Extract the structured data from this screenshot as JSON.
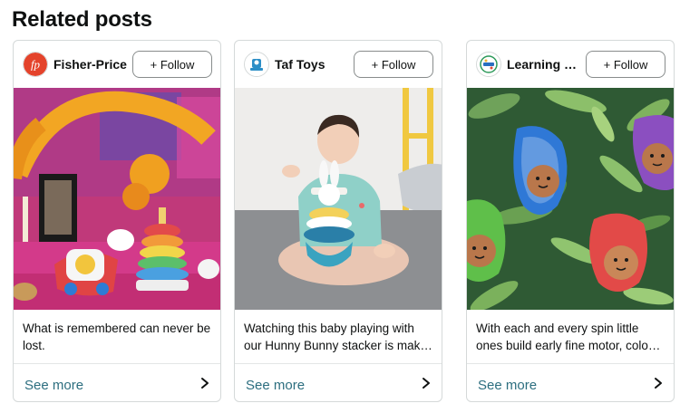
{
  "section": {
    "title": "Related posts"
  },
  "posts": [
    {
      "brand": "Fisher-Price",
      "avatar_icon": "fisher-price-logo-icon",
      "follow_label": "+ Follow",
      "image_icon": "day-of-the-dead-altar-toys-image",
      "caption": "What is remembered can never be lost.",
      "see_more": "See more"
    },
    {
      "brand": "Taf Toys",
      "avatar_icon": "taf-toys-logo-icon",
      "follow_label": "+ Follow",
      "image_icon": "baby-playing-stacker-image",
      "caption": "Watching this baby playing with our Hunny Bunny stacker is mak…",
      "see_more": "See more"
    },
    {
      "brand": "Learning R...",
      "avatar_icon": "learning-resources-logo-icon",
      "follow_label": "+ Follow",
      "image_icon": "avocado-spinning-toys-image",
      "caption": "With each and every spin little ones build early fine motor, colo…",
      "see_more": "See more"
    }
  ],
  "colors": {
    "link": "#2c6e7f",
    "border": "#d5d9d9",
    "fisher_price_red": "#e4432b"
  }
}
